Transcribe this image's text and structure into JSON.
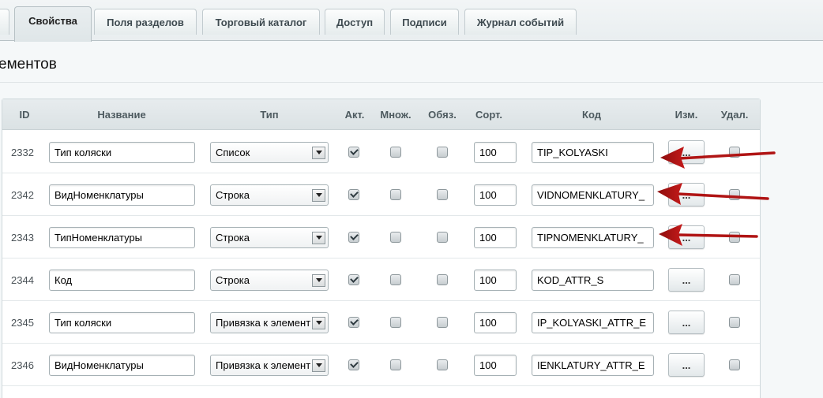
{
  "tabs": [
    {
      "label": "Свойства",
      "active": true
    },
    {
      "label": "Поля разделов",
      "active": false
    },
    {
      "label": "Торговый каталог",
      "active": false
    },
    {
      "label": "Доступ",
      "active": false
    },
    {
      "label": "Подписи",
      "active": false
    },
    {
      "label": "Журнал событий",
      "active": false
    }
  ],
  "section": {
    "title": "ементов"
  },
  "table": {
    "headers": {
      "id": "ID",
      "name": "Название",
      "type": "Тип",
      "active": "Акт.",
      "multiple": "Множ.",
      "required": "Обяз.",
      "sort": "Сорт.",
      "code": "Код",
      "edit": "Изм.",
      "delete": "Удал."
    },
    "rows": [
      {
        "id": "2332",
        "name": "Тип коляски",
        "type": "Список",
        "active": true,
        "multiple": false,
        "required": false,
        "sort": "100",
        "code": "TIP_KOLYASKI",
        "edit": "...",
        "delete": false
      },
      {
        "id": "2342",
        "name": "ВидНоменклатуры",
        "type": "Строка",
        "active": true,
        "multiple": false,
        "required": false,
        "sort": "100",
        "code": "VIDNOMENKLATURY_",
        "edit": "...",
        "delete": false
      },
      {
        "id": "2343",
        "name": "ТипНоменклатуры",
        "type": "Строка",
        "active": true,
        "multiple": false,
        "required": false,
        "sort": "100",
        "code": "TIPNOMENKLATURY_",
        "edit": "...",
        "delete": false
      },
      {
        "id": "2344",
        "name": "Код",
        "type": "Строка",
        "active": true,
        "multiple": false,
        "required": false,
        "sort": "100",
        "code": "KOD_ATTR_S",
        "edit": "...",
        "delete": false
      },
      {
        "id": "2345",
        "name": "Тип коляски",
        "type": "Привязка к элемент",
        "active": true,
        "multiple": false,
        "required": false,
        "sort": "100",
        "code": "IP_KOLYASKI_ATTR_E",
        "edit": "...",
        "delete": false
      },
      {
        "id": "2346",
        "name": "ВидНоменклатуры",
        "type": "Привязка к элемент",
        "active": true,
        "multiple": false,
        "required": false,
        "sort": "100",
        "code": "IENKLATURY_ATTR_E",
        "edit": "...",
        "delete": false
      }
    ]
  },
  "colors": {
    "annotation_arrow": "#b01414",
    "header_bg": "#dbe2e4",
    "page_bg": "#f5f8f9"
  }
}
